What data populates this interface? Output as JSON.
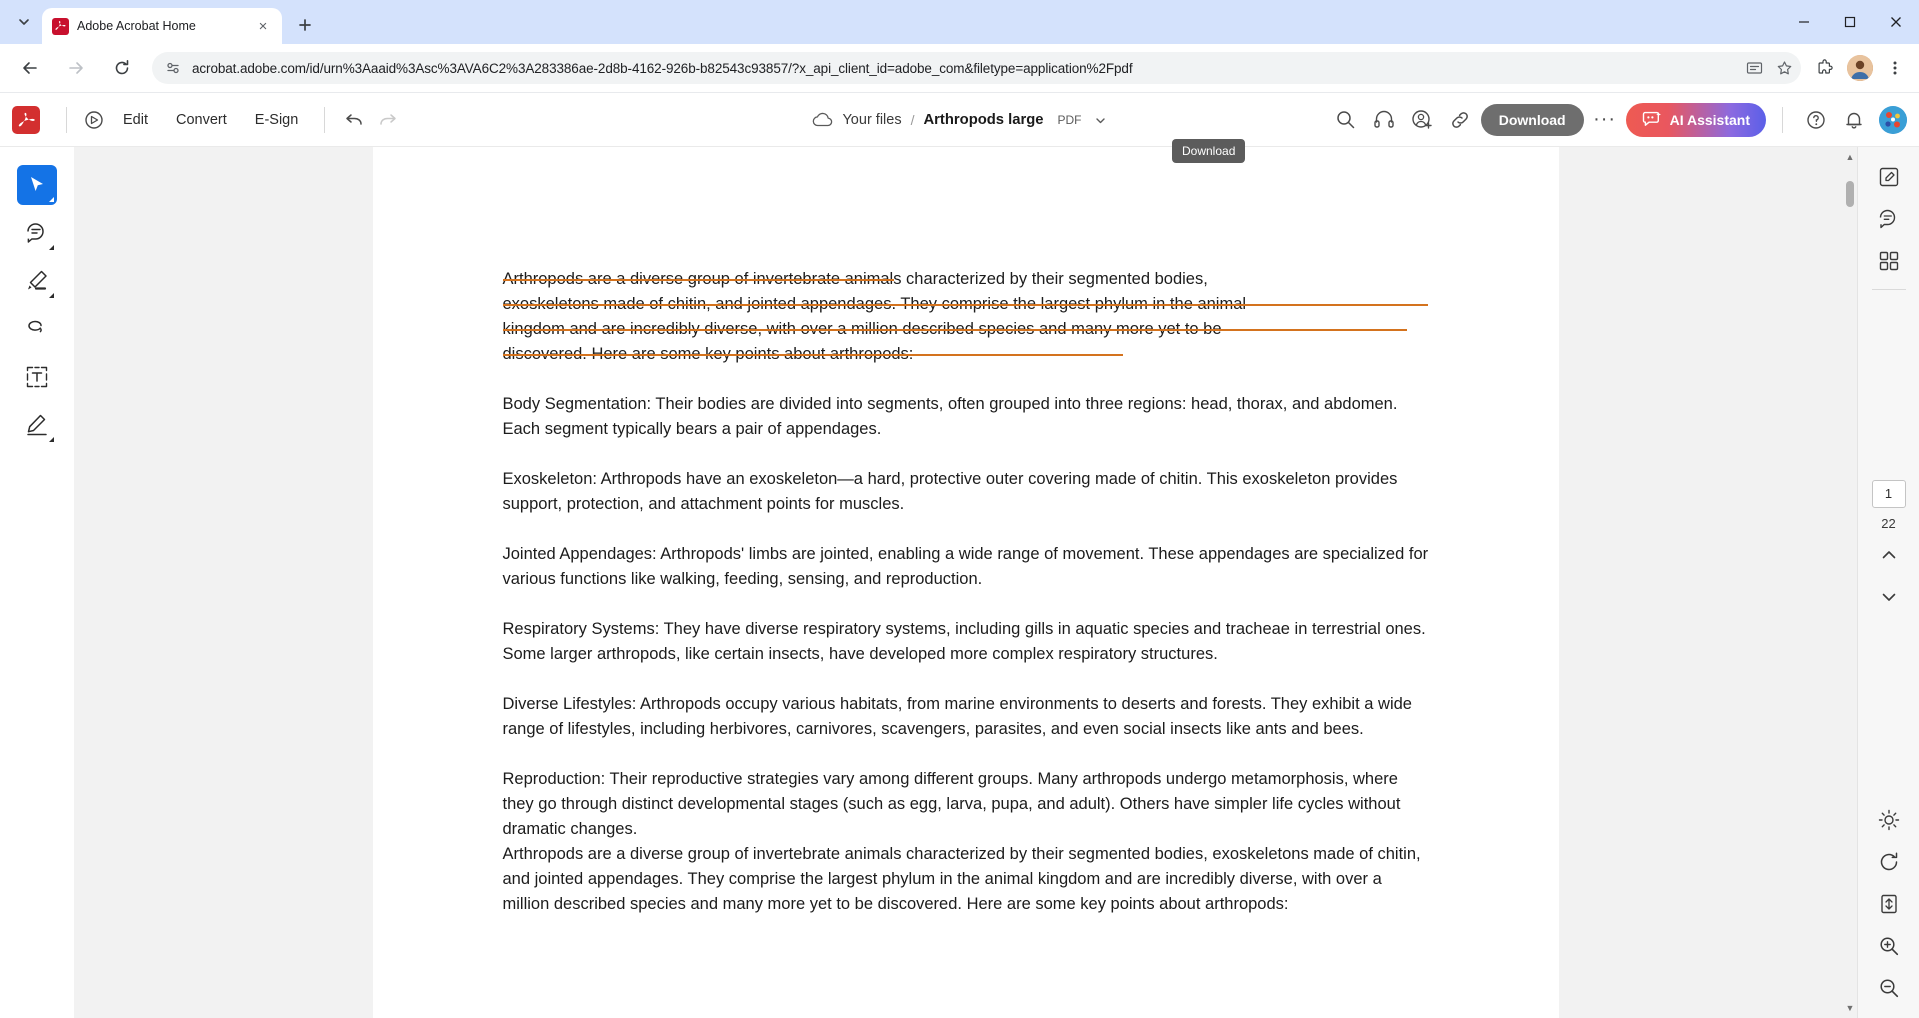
{
  "browser": {
    "tab": {
      "title": "Adobe Acrobat Home",
      "favicon": "adobe-acrobat-icon",
      "close": "×"
    },
    "new_tab_label": "+",
    "window_controls": {
      "minimize": "—",
      "maximize": "□",
      "close": "✕"
    },
    "nav": {
      "back": "←",
      "forward": "→",
      "reload": "↻"
    },
    "omnibox": {
      "url": "acrobat.adobe.com/id/urn%3Aaaid%3Asc%3AVA6C2%3A283386ae-2d8b-4162-926b-b82543c93857/?x_api_client_id=adobe_com&filetype=application%2Fpdf",
      "site_icon": "page-settings-icon",
      "cast_icon": "cast-icon",
      "bookmark_icon": "star-icon",
      "extensions_icon": "puzzle-icon",
      "menu_icon": "kebab-menu-icon"
    }
  },
  "acrobat": {
    "logo": "adobe-acrobat-logo",
    "menus": [
      {
        "name": "scan-icon",
        "label": ""
      },
      {
        "name": "edit",
        "label": "Edit"
      },
      {
        "name": "convert",
        "label": "Convert"
      },
      {
        "name": "esign",
        "label": "E-Sign"
      }
    ],
    "edit_label": "Edit",
    "convert_label": "Convert",
    "esign_label": "E-Sign",
    "undo_label": "↶",
    "redo_label": "↷",
    "breadcrumb": {
      "cloud_icon": "cloud-icon",
      "root": "Your files",
      "separator": "/",
      "file_name": "Arthropods large",
      "file_type": "PDF",
      "chevron": "∨"
    },
    "right_actions": {
      "search_icon": "search-icon",
      "listen_icon": "headphones-icon",
      "share_user_icon": "add-person-icon",
      "link_icon": "link-icon",
      "download_label": "Download",
      "more_label": "···",
      "ai_assistant_label": "AI Assistant",
      "help_icon": "question-circle-icon",
      "notifications_icon": "bell-icon",
      "avatar": "user-avatar"
    },
    "tooltip": {
      "text": "Download"
    },
    "left_tools": [
      {
        "name": "select-tool",
        "glyph": "cursor",
        "active": true,
        "has_caret": true
      },
      {
        "name": "comment-tool",
        "glyph": "comment",
        "active": false,
        "has_caret": true
      },
      {
        "name": "highlight-tool",
        "glyph": "highlighter",
        "active": false,
        "has_caret": true
      },
      {
        "name": "draw-tool",
        "glyph": "lasso",
        "active": false,
        "has_caret": false
      },
      {
        "name": "text-box-tool",
        "glyph": "textbox",
        "active": false,
        "has_caret": false
      },
      {
        "name": "signature-tool",
        "glyph": "signature",
        "active": false,
        "has_caret": true
      }
    ],
    "right_rail": {
      "icons_top": [
        {
          "name": "edit-panel-icon",
          "glyph": "edit-square"
        },
        {
          "name": "comments-panel-icon",
          "glyph": "comment-bubble"
        },
        {
          "name": "thumbnails-panel-icon",
          "glyph": "grid"
        }
      ],
      "page_current": "1",
      "page_total": "22",
      "prev_page": "∧",
      "next_page": "∨",
      "icons_bottom": [
        {
          "name": "brightness-icon",
          "glyph": "sun"
        },
        {
          "name": "rotate-icon",
          "glyph": "rotate"
        },
        {
          "name": "fit-page-icon",
          "glyph": "fit"
        },
        {
          "name": "zoom-in-icon",
          "glyph": "zoom-in"
        },
        {
          "name": "zoom-out-icon",
          "glyph": "zoom-out"
        }
      ]
    },
    "scrollbar": {
      "up_arrow": "▲",
      "down_arrow": "▼"
    }
  },
  "document": {
    "struck_paragraph": {
      "lines": [
        "Arthropods are a diverse group of invertebrate animals characterized by their segmented bodies,",
        "exoskeletons made of chitin, and jointed appendages. They comprise the largest phylum in the animal",
        "kingdom and are incredibly diverse, with over a million described species and many more yet to be",
        "discovered. Here are some key points about arthropods:"
      ],
      "strike_color": "#d4731e"
    },
    "paragraphs": [
      "Body Segmentation: Their bodies are divided into segments, often grouped into three regions: head, thorax, and abdomen. Each segment typically bears a pair of appendages.",
      "Exoskeleton: Arthropods have an exoskeleton—a hard, protective outer covering made of chitin. This exoskeleton provides support, protection, and attachment points for muscles.",
      "Jointed Appendages: Arthropods' limbs are jointed, enabling a wide range of movement. These appendages are specialized for various functions like walking, feeding, sensing, and reproduction.",
      "Respiratory Systems: They have diverse respiratory systems, including gills in aquatic species and tracheae in terrestrial ones. Some larger arthropods, like certain insects, have developed more complex respiratory structures.",
      "Diverse Lifestyles: Arthropods occupy various habitats, from marine environments to deserts and forests. They exhibit a wide range of lifestyles, including herbivores, carnivores, scavengers, parasites, and even social insects like ants and bees.",
      "Reproduction: Their reproductive strategies vary among different groups. Many arthropods undergo metamorphosis, where they go through distinct developmental stages (such as egg, larva, pupa, and adult). Others have simpler life cycles without dramatic changes."
    ],
    "repeat_paragraph": "Arthropods are a diverse group of invertebrate animals characterized by their segmented bodies, exoskeletons made of chitin, and jointed appendages. They comprise the largest phylum in the animal kingdom and are incredibly diverse, with over a million described species and many more yet to be discovered. Here are some key points about arthropods:"
  },
  "colors": {
    "brand_red": "#d32f2f",
    "accent_blue": "#1473e6",
    "strike_orange": "#d4731e",
    "chrome_tabstrip": "#d4e2fc",
    "download_gray": "#6e6e6e"
  }
}
